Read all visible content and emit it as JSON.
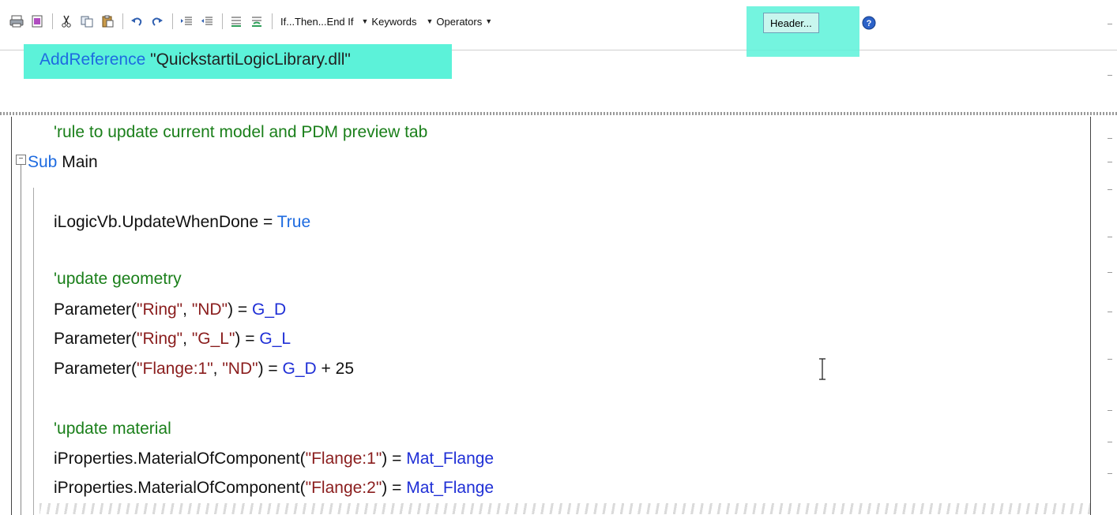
{
  "toolbar": {
    "buttons": [
      {
        "name": "print-icon",
        "title": "Print"
      },
      {
        "name": "print-preview-icon",
        "title": "Print Preview"
      },
      {
        "name": "cut-icon",
        "title": "Cut"
      },
      {
        "name": "copy-icon",
        "title": "Copy"
      },
      {
        "name": "paste-icon",
        "title": "Paste"
      },
      {
        "name": "undo-icon",
        "title": "Undo"
      },
      {
        "name": "redo-icon",
        "title": "Redo"
      },
      {
        "name": "indent-icon",
        "title": "Increase Indent"
      },
      {
        "name": "outdent-icon",
        "title": "Decrease Indent"
      },
      {
        "name": "comment-icon",
        "title": "Comment"
      },
      {
        "name": "uncomment-icon",
        "title": "Uncomment"
      }
    ],
    "if_then_label": "If...Then...End If",
    "keywords_label": "Keywords",
    "operators_label": "Operators",
    "header_label": "Header...",
    "help_icon": "help-icon",
    "highlight_color": "#5cf2d9"
  },
  "header_code": {
    "keyword": "AddReference",
    "string": "\"QuickstartiLogicLibrary.dll\""
  },
  "code": {
    "comment1": "'rule to update current model and PDM preview tab",
    "sub_kw": "Sub",
    "sub_name": " Main",
    "update_when_done_prefix": "iLogicVb.UpdateWhenDone = ",
    "true_kw": "True",
    "comment2": "'update geometry",
    "p1_a": "Parameter(",
    "p1_s1": "\"Ring\"",
    "p1_b": ", ",
    "p1_s2": "\"ND\"",
    "p1_c": ") = ",
    "p1_v": "G_D",
    "p2_a": "Parameter(",
    "p2_s1": "\"Ring\"",
    "p2_b": ", ",
    "p2_s2": "\"G_L\"",
    "p2_c": ") = ",
    "p2_v": "G_L",
    "p3_a": "Parameter(",
    "p3_s1": "\"Flange:1\"",
    "p3_b": ", ",
    "p3_s2": "\"ND\"",
    "p3_c": ") = ",
    "p3_v": "G_D",
    "p3_d": " + 25",
    "comment3": "'update material",
    "m1_a": "iProperties.MaterialOfComponent(",
    "m1_s": "\"Flange:1\"",
    "m1_c": ") = ",
    "m1_v": "Mat_Flange",
    "m2_a": "iProperties.MaterialOfComponent(",
    "m2_s": "\"Flange:2\"",
    "m2_c": ") = ",
    "m2_v": "Mat_Flange",
    "fold_symbol": "−"
  },
  "colors": {
    "keyword": "#1e6be0",
    "variable": "#1f2fd6",
    "string": "#8a1d1d",
    "comment": "#1a7f1a"
  }
}
